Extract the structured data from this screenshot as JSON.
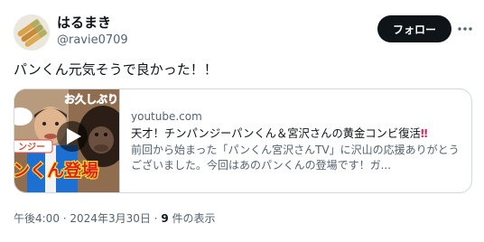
{
  "author": {
    "display_name": "はるまき",
    "handle": "@ravie0709",
    "avatar_icon": "spring-roll-avatar-icon"
  },
  "follow_label": "フォロー",
  "more_icon": "more-horizontal-icon",
  "tweet": {
    "text": "パンくん元気そうで良かった！！"
  },
  "card": {
    "domain": "youtube.com",
    "title": "天才！チンパンジーパンくん＆宮沢さんの黄金コンビ復活",
    "title_emoji": "‼",
    "description": "前回から始まった「パンくん宮沢さんTV」に沢山の応援ありがとうございました。今回はあのパンくんの登場です！ガ...",
    "thumbnail": {
      "top_right_text": "お久しぶり",
      "left_text": "ンジー",
      "main_text": "ンくん登場",
      "play_icon": "play-button-icon"
    }
  },
  "meta": {
    "time": "午後4:00",
    "separator": " · ",
    "date": "2024年3月30日",
    "separator2": " · ",
    "views_count": "9",
    "views_label": " 件の表示"
  }
}
